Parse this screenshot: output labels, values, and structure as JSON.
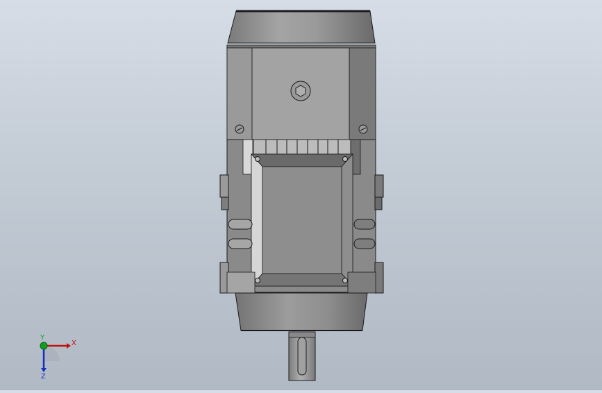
{
  "viewport": {
    "view": "3D model view"
  },
  "triad": {
    "x_label": "X",
    "y_label": "Y",
    "z_label": "Z",
    "colors": {
      "x": "#c01010",
      "y": "#10a020",
      "z": "#1030c0"
    }
  },
  "model": {
    "colors": {
      "body": "#8a8a8a",
      "body_light": "#a5a5a5",
      "body_dark": "#6e6e6e",
      "outline": "#1a1a1a"
    }
  }
}
